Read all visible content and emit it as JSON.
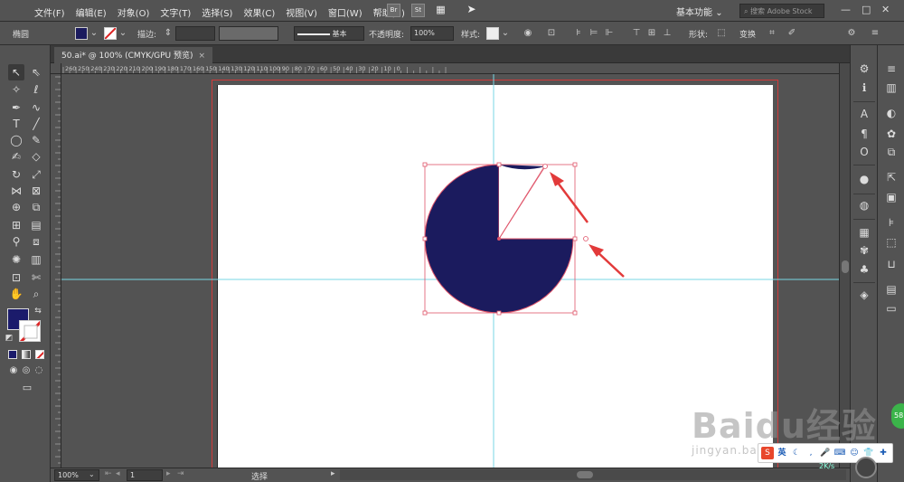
{
  "menu": {
    "items": [
      "文件(F)",
      "编辑(E)",
      "对象(O)",
      "文字(T)",
      "选择(S)",
      "效果(C)",
      "视图(V)",
      "窗口(W)",
      "帮助(H)"
    ],
    "bridge": "Br",
    "stock": "St",
    "workspace": "基本功能",
    "search_placeholder": "搜索 Adobe Stock"
  },
  "control": {
    "path_label": "椭圆",
    "fill_color": "#1b1b5e",
    "stroke_label": "描边:",
    "line_style": "基本",
    "opacity_label": "不透明度:",
    "opacity_value": "100%",
    "style_label": "样式:",
    "shape_label": "形状:",
    "transform_label": "变换"
  },
  "document": {
    "tab_title": "50.ai* @ 100% (CMYK/GPU 预览)",
    "close": "×"
  },
  "ruler": {
    "h_ticks": [
      "260",
      "250",
      "240",
      "230",
      "220",
      "210",
      "200",
      "190",
      "180",
      "170",
      "160",
      "150",
      "140",
      "130",
      "120",
      "110",
      "100",
      "90",
      "80",
      "70",
      "60",
      "50",
      "40",
      "30",
      "20",
      "10",
      "0"
    ]
  },
  "toolbar": {
    "fill_color": "#1b1b6b"
  },
  "status": {
    "zoom": "100%",
    "page": "1",
    "mode": "选择"
  },
  "shape": {
    "fill": "#1b1b5e",
    "stroke": "#e0556a",
    "guide_color": "#7ad7e6",
    "arrow_color": "#e23a3a"
  },
  "watermark": {
    "brand": "Baidu经验",
    "url": "jingyan.baidu.com"
  },
  "overlay": {
    "speed": "2K/s",
    "badge": "58"
  }
}
